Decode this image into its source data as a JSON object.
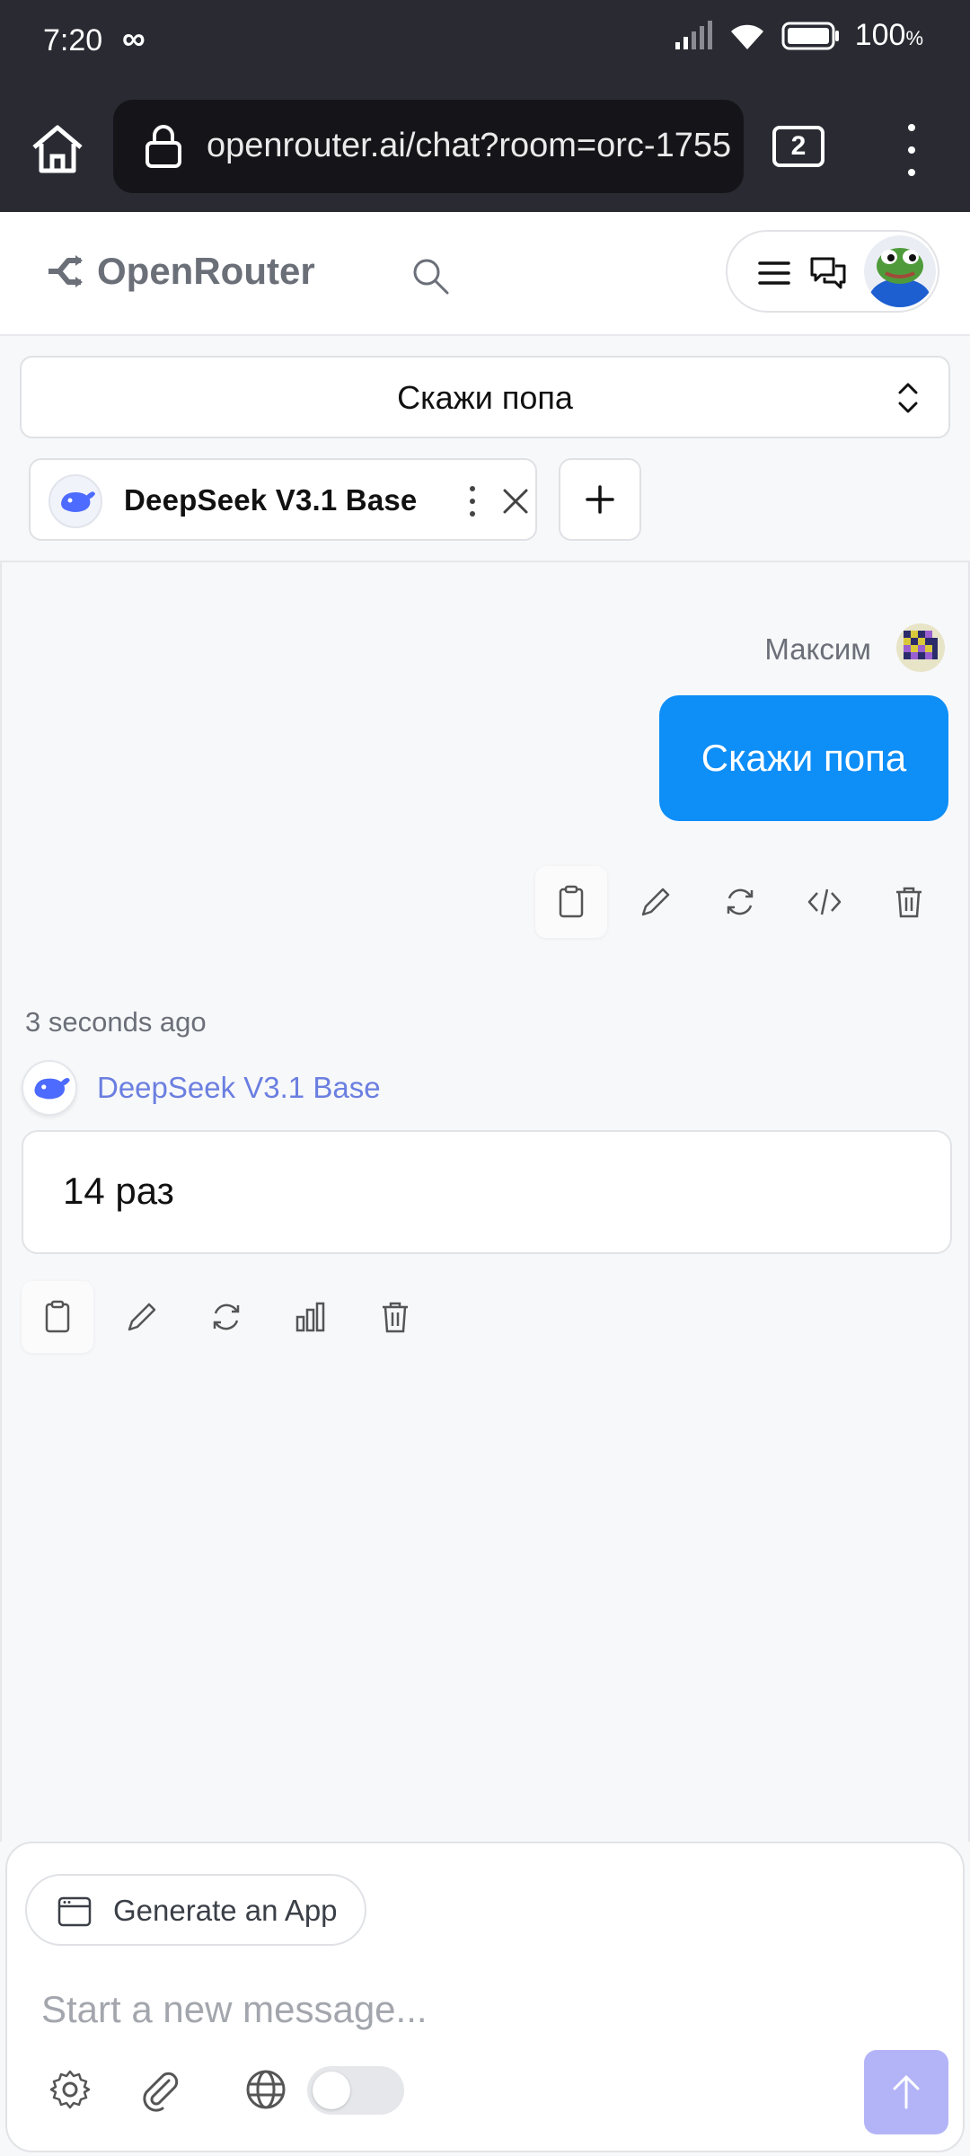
{
  "status_bar": {
    "time": "7:20",
    "battery": "100",
    "battery_unit": "%"
  },
  "browser": {
    "url": "openrouter.ai/chat?room=orc-1755",
    "tab_count": "2"
  },
  "header": {
    "brand": "OpenRouter"
  },
  "conversation": {
    "title": "Скажи попа"
  },
  "model_chip": {
    "label": "DeepSeek V3.1 Base"
  },
  "messages": {
    "user": {
      "name": "Максим",
      "text": "Скажи попа"
    },
    "bot": {
      "timestamp": "3 seconds ago",
      "model": "DeepSeek V3.1 Base",
      "text": "14 раз"
    }
  },
  "composer": {
    "generate_app_label": "Generate an App",
    "placeholder": "Start a new message..."
  },
  "colors": {
    "accent_blue": "#0e8ef7",
    "model_name": "#6b7fe0",
    "send_button": "#b3b4f7"
  }
}
